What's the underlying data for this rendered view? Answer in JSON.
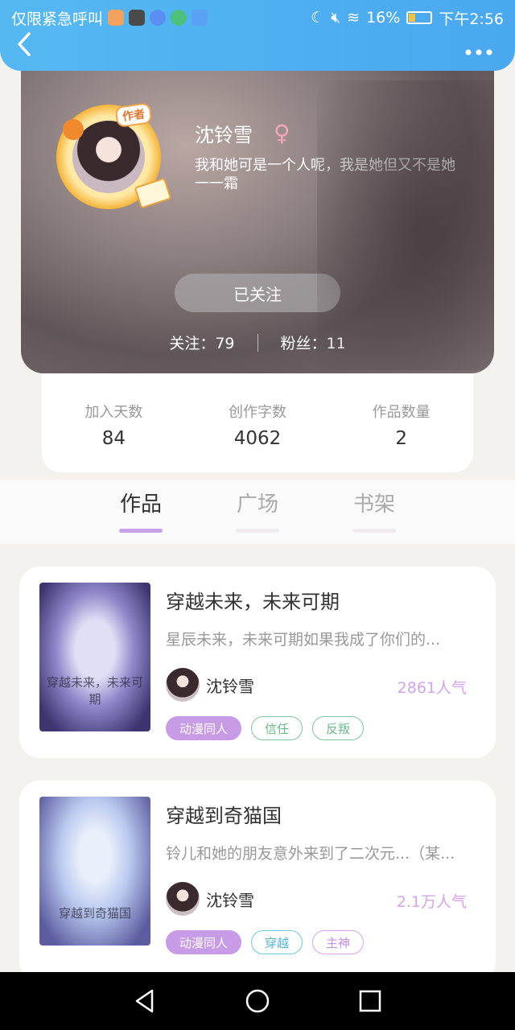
{
  "status_bar": {
    "carrier": "仅限紧急呼叫",
    "battery": "16%",
    "time": "下午2:56",
    "app_icon_colors": [
      "#f2a25c",
      "#4a4a4a",
      "#5b8ef3",
      "#4cc07c",
      "#5aa0f5"
    ]
  },
  "header": {
    "back_icon": "chevron-left-icon",
    "more_icon": "more-dots-icon",
    "accent": "#4ea9f0"
  },
  "profile": {
    "avatar_badge": "作者",
    "name": "沈铃雪",
    "gender_symbol": "♀",
    "bio": "我和她可是一个人呢，我是她但又不是她　　一一霜",
    "follow_button": "已关注",
    "following": "关注：79",
    "fans": "粉丝：11"
  },
  "stats": [
    {
      "label": "加入天数",
      "value": "84"
    },
    {
      "label": "创作字数",
      "value": "4062"
    },
    {
      "label": "作品数量",
      "value": "2"
    }
  ],
  "tabs": [
    {
      "label": "作品",
      "active": true
    },
    {
      "label": "广场",
      "active": false
    },
    {
      "label": "书架",
      "active": false
    }
  ],
  "works": [
    {
      "title": "穿越未来，未来可期",
      "description": "星辰未来，未来可期如果我成了你们的...",
      "cover_text": "穿越未来，未来可期",
      "author": "沈铃雪",
      "popularity": "2861人气",
      "tags": [
        {
          "label": "动漫同人",
          "color": "#c79be6",
          "filled": true
        },
        {
          "label": "信任",
          "color": "#7cc79b",
          "filled": false
        },
        {
          "label": "反叛",
          "color": "#7cc79b",
          "filled": false
        }
      ]
    },
    {
      "title": "穿越到奇猫国",
      "description": "铃儿和她的朋友意外来到了二次元...（某...",
      "cover_text": "穿越到奇猫国",
      "author": "沈铃雪",
      "popularity": "2.1万人气",
      "tags": [
        {
          "label": "动漫同人",
          "color": "#c79be6",
          "filled": true
        },
        {
          "label": "穿越",
          "color": "#6cc8e0",
          "filled": false
        },
        {
          "label": "主神",
          "color": "#d4a4ea",
          "filled": false
        }
      ]
    }
  ],
  "nav": {
    "back": "triangle-back-icon",
    "home": "circle-home-icon",
    "recents": "square-recents-icon"
  }
}
